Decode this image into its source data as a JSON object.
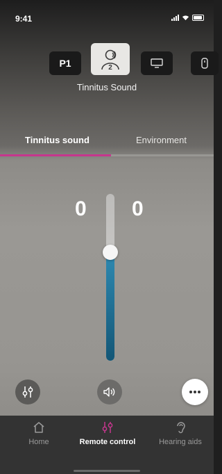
{
  "status": {
    "time": "9:41"
  },
  "programs": {
    "items": [
      {
        "label": "P1",
        "icon": "text-p1"
      },
      {
        "label": "2",
        "icon": "tinnitus-user-icon",
        "selected": true
      },
      {
        "label": "",
        "icon": "tv-icon"
      },
      {
        "label": "",
        "icon": "remote-icon"
      }
    ],
    "selected_name": "Tinnitus Sound"
  },
  "tabs": [
    {
      "label": "Tinnitus sound",
      "active": true
    },
    {
      "label": "Environment",
      "active": false
    }
  ],
  "volume": {
    "left": "0",
    "right": "0",
    "level": 0.65
  },
  "controls": {
    "equalizer_icon": "equalizer-icon",
    "speaker_icon": "speaker-icon",
    "more_icon": "more-icon"
  },
  "nav": {
    "items": [
      {
        "label": "Home",
        "icon": "home-icon",
        "active": false
      },
      {
        "label": "Remote control",
        "icon": "equalizer-icon",
        "active": true
      },
      {
        "label": "Hearing aids",
        "icon": "ear-icon",
        "active": false
      }
    ]
  },
  "colors": {
    "accent": "#c6368e",
    "slider_fill": "#1f6f94",
    "nav_bg": "#333333"
  }
}
